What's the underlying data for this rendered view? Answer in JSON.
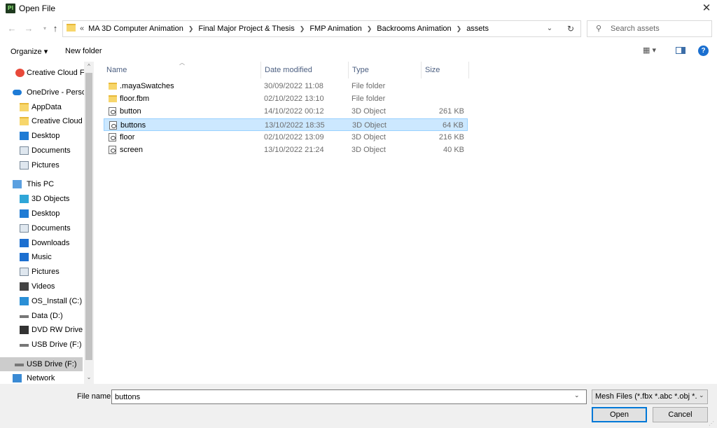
{
  "window": {
    "title": "Open File",
    "app_icon_text": "Pl"
  },
  "address": {
    "overflow": "«",
    "crumbs": [
      "MA 3D Computer Animation",
      "Final Major Project & Thesis",
      "FMP Animation",
      "Backrooms Animation",
      "assets"
    ],
    "search_placeholder": "Search assets"
  },
  "toolbar": {
    "organize": "Organize ▾",
    "new_folder": "New folder"
  },
  "nav": {
    "items": [
      {
        "label": "Creative Cloud Fil",
        "icon": "creative-cloud-icon"
      },
      {
        "label": "OneDrive - Person",
        "icon": "onedrive-icon"
      },
      {
        "label": "AppData",
        "icon": "folder-icon"
      },
      {
        "label": "Creative Cloud F",
        "icon": "folder-icon"
      },
      {
        "label": "Desktop",
        "icon": "desktop-icon"
      },
      {
        "label": "Documents",
        "icon": "documents-icon"
      },
      {
        "label": "Pictures",
        "icon": "pictures-icon"
      },
      {
        "label": "This PC",
        "icon": "this-pc-icon"
      },
      {
        "label": "3D Objects",
        "icon": "3d-objects-icon"
      },
      {
        "label": "Desktop",
        "icon": "desktop-icon"
      },
      {
        "label": "Documents",
        "icon": "documents-icon"
      },
      {
        "label": "Downloads",
        "icon": "downloads-icon"
      },
      {
        "label": "Music",
        "icon": "music-icon"
      },
      {
        "label": "Pictures",
        "icon": "pictures-icon"
      },
      {
        "label": "Videos",
        "icon": "videos-icon"
      },
      {
        "label": "OS_Install (C:)",
        "icon": "windows-drive-icon"
      },
      {
        "label": "Data (D:)",
        "icon": "drive-icon"
      },
      {
        "label": "DVD RW Drive (E",
        "icon": "dvd-drive-icon"
      },
      {
        "label": "USB Drive (F:)",
        "icon": "usb-drive-icon"
      },
      {
        "label": "USB Drive (F:)",
        "icon": "usb-drive-icon"
      },
      {
        "label": "Network",
        "icon": "network-icon"
      }
    ]
  },
  "columns": {
    "name": "Name",
    "date": "Date modified",
    "type": "Type",
    "size": "Size"
  },
  "files": [
    {
      "name": ".mayaSwatches",
      "date": "30/09/2022 11:08",
      "type": "File folder",
      "size": "",
      "icon": "folder-icon"
    },
    {
      "name": "floor.fbm",
      "date": "02/10/2022 13:10",
      "type": "File folder",
      "size": "",
      "icon": "folder-icon"
    },
    {
      "name": "button",
      "date": "14/10/2022 00:12",
      "type": "3D Object",
      "size": "261 KB",
      "icon": "3d-file-icon"
    },
    {
      "name": "buttons",
      "date": "13/10/2022 18:35",
      "type": "3D Object",
      "size": "64 KB",
      "icon": "3d-file-icon",
      "selected": true
    },
    {
      "name": "floor",
      "date": "02/10/2022 13:09",
      "type": "3D Object",
      "size": "216 KB",
      "icon": "3d-file-icon"
    },
    {
      "name": "screen",
      "date": "13/10/2022 21:24",
      "type": "3D Object",
      "size": "40 KB",
      "icon": "3d-file-icon"
    }
  ],
  "bottom": {
    "file_name_label": "File name:",
    "file_name_value": "buttons",
    "file_type": "Mesh Files (*.fbx *.abc *.obj *.d",
    "open": "Open",
    "cancel": "Cancel"
  },
  "colors": {
    "selection": "#cce8ff",
    "accent": "#0078d7",
    "header_text": "#4d6082"
  }
}
